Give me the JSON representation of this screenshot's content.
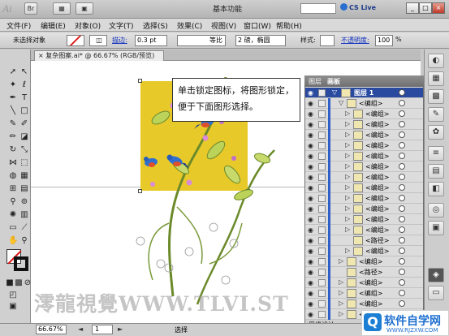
{
  "app": {
    "logo_text": "Ai",
    "workspace": "基本功能",
    "cs_live": "CS Live",
    "window_buttons": [
      "_",
      "□",
      "×"
    ]
  },
  "menu": {
    "items": [
      "文件(F)",
      "编辑(E)",
      "对象(O)",
      "文字(T)",
      "选择(S)",
      "效果(C)",
      "视图(V)",
      "窗口(W)",
      "帮助(H)"
    ]
  },
  "controlbar": {
    "selection": "未选择对象",
    "stroke_label": "描边:",
    "stroke_value": "0.3 pt",
    "profile_label": "等比",
    "brush_value": "2 磅，椭圆",
    "style_label": "样式:",
    "opacity_label": "不透明度:",
    "opacity_value": "100",
    "opacity_unit": "%"
  },
  "document": {
    "tab_title": "复杂图案.ai* @ 66.67% (RGB/预览)",
    "close_icon": "×"
  },
  "callout": {
    "text": "单击锁定图标，将图形锁定，便于下面图形选择。"
  },
  "layers_panel": {
    "tabs": [
      "图层",
      "画板"
    ],
    "top_layer": "图层 1",
    "rows": [
      {
        "label": "<编组>",
        "depth": 1,
        "arrow": "▽"
      },
      {
        "label": "<编组>",
        "depth": 2,
        "arrow": "▷"
      },
      {
        "label": "<编组>",
        "depth": 2,
        "arrow": "▷"
      },
      {
        "label": "<编组>",
        "depth": 2,
        "arrow": "▷"
      },
      {
        "label": "<编组>",
        "depth": 2,
        "arrow": "▷"
      },
      {
        "label": "<编组>",
        "depth": 2,
        "arrow": "▷"
      },
      {
        "label": "<编组>",
        "depth": 2,
        "arrow": "▷"
      },
      {
        "label": "<编组>",
        "depth": 2,
        "arrow": "▷"
      },
      {
        "label": "<编组>",
        "depth": 2,
        "arrow": "▷"
      },
      {
        "label": "<编组>",
        "depth": 2,
        "arrow": "▷"
      },
      {
        "label": "<编组>",
        "depth": 2,
        "arrow": "▷"
      },
      {
        "label": "<编组>",
        "depth": 2,
        "arrow": "▷"
      },
      {
        "label": "<编组>",
        "depth": 2,
        "arrow": "▷"
      },
      {
        "label": "<路径>",
        "depth": 2,
        "arrow": ""
      },
      {
        "label": "<编组>",
        "depth": 2,
        "arrow": "▷"
      },
      {
        "label": "<编组>",
        "depth": 1,
        "arrow": "▷"
      },
      {
        "label": "<路径>",
        "depth": 1,
        "arrow": ""
      },
      {
        "label": "<编组>",
        "depth": 1,
        "arrow": "▷"
      },
      {
        "label": "<编组>",
        "depth": 1,
        "arrow": "▷"
      },
      {
        "label": "<编组>",
        "depth": 1,
        "arrow": "▷"
      },
      {
        "label": "<编组>",
        "depth": 1,
        "arrow": "▷"
      }
    ],
    "footer_text": "思缘设计"
  },
  "statusbar": {
    "zoom": "66.67%",
    "page": "1",
    "status": "选择",
    "pager_prev": "◄",
    "pager_next": "►"
  },
  "watermark": {
    "text": "澪龍視覺WWW.TLVI.ST"
  },
  "site_badge": {
    "logo_char": "Q",
    "name": "软件自学网",
    "url": "WWW.RJZXW.COM"
  },
  "colors": {
    "artboard_fill": "#e8c92a",
    "selection_blue": "#2a4aa0",
    "link_blue": "#1030c0"
  }
}
